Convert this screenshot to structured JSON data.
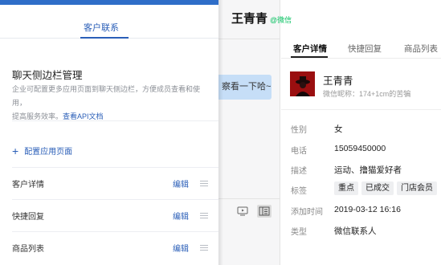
{
  "admin": {
    "tab_active": "客户联系",
    "section_title": "聊天侧边栏管理",
    "description_line1": "企业可配置更多应用页面到聊天侧边栏，方便成员查看和使用，",
    "description_line2": "提高服务效率。",
    "description_link": "查看API文档",
    "add_label": "配置应用页面",
    "items": [
      {
        "label": "客户详情",
        "edit": "编辑"
      },
      {
        "label": "快捷回复",
        "edit": "编辑"
      },
      {
        "label": "商品列表",
        "edit": "编辑"
      }
    ]
  },
  "chat": {
    "bubble_text": "察看一下哈~"
  },
  "profile": {
    "name": "王青青",
    "wechat_tag": "@微信",
    "tabs": [
      "客户详情",
      "快捷回复",
      "商品列表"
    ],
    "active_tab": "客户详情",
    "card_name": "王青青",
    "nickname": "微信昵称：174+1cm的苦犏",
    "fields": {
      "gender_label": "性别",
      "gender": "女",
      "phone_label": "电话",
      "phone": "15059450000",
      "desc_label": "描述",
      "desc": "运动、撸猫爱好者",
      "tags_label": "标签",
      "added_label": "添加时间",
      "added": "2019-03-12 16:16",
      "type_label": "类型",
      "type": "微信联系人"
    },
    "tags": [
      "重点",
      "已成交",
      "门店会员"
    ]
  },
  "colors": {
    "accent": "#2b5fb8",
    "wechat_green": "#07c160",
    "bubble": "#c6def7"
  }
}
